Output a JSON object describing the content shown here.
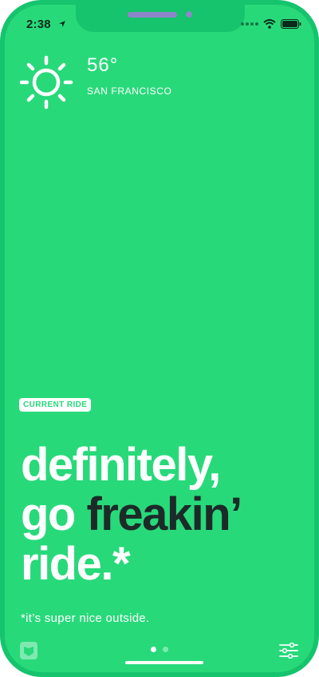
{
  "status_bar": {
    "time": "2:38"
  },
  "weather": {
    "icon": "sun-icon",
    "temperature": "56°",
    "city": "SAN FRANCISCO"
  },
  "ride": {
    "badge": "CURRENT RIDE",
    "headline_line1": "definitely,",
    "headline_line2_a": "go",
    "headline_line2_b": "freakin’",
    "headline_line3": "ride.*",
    "footnote": "*it’s super nice outside."
  },
  "colors": {
    "background": "#28d97a",
    "frame": "#15c46c",
    "accent_text": "#1c2a28",
    "text": "#ffffff"
  },
  "bottom_bar": {
    "left_icon": "history-card-icon",
    "right_icon": "settings-sliders-icon",
    "pages": 2,
    "active_page": 1
  }
}
